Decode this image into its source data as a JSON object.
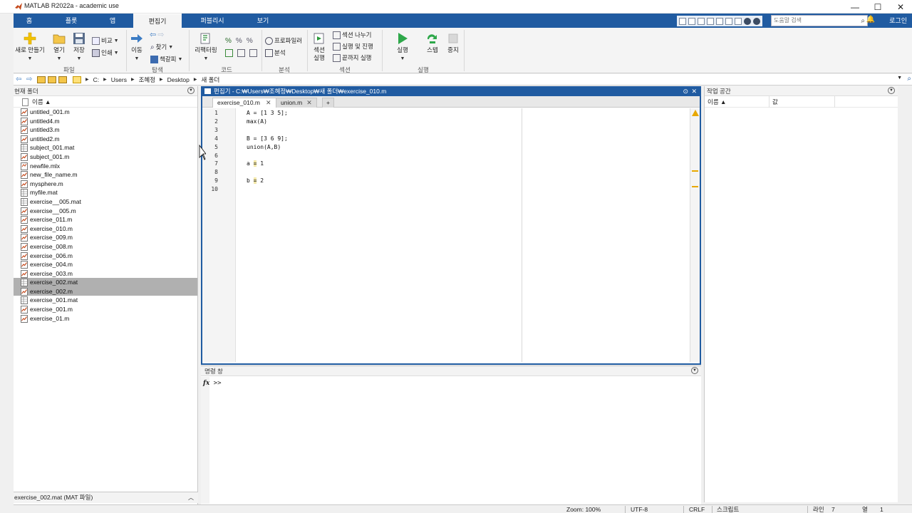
{
  "window": {
    "title": "MATLAB R2022a - academic use",
    "minimize": "—",
    "maximize": "☐",
    "close": "✕"
  },
  "ribbon_tabs": [
    {
      "label": "홈"
    },
    {
      "label": "플롯"
    },
    {
      "label": "앱"
    },
    {
      "label": "편집기"
    },
    {
      "label": "퍼블리시"
    },
    {
      "label": "보기"
    }
  ],
  "active_tab": "편집기",
  "help_search": {
    "placeholder": "도움말 검색"
  },
  "login_label": "로그인",
  "ribbon": {
    "file": {
      "group": "파일",
      "new": "새로 만들기",
      "open": "열기",
      "save": "저장",
      "compare": "비교",
      "print": "인쇄"
    },
    "navigate": {
      "group": "탐색",
      "goto": "이동",
      "find": "찾기",
      "bookmark": "책갈피"
    },
    "code": {
      "group": "코드",
      "refactor": "리팩터링"
    },
    "analyze": {
      "group": "분석",
      "profiler": "프로파일러",
      "analyze": "분석"
    },
    "section": {
      "group": "섹션",
      "run_section_1": "섹션",
      "run_section_2": "실행",
      "section_break": "섹션 나누기",
      "run_advance": "실행 및 진행",
      "run_to_end": "끝까지 실행"
    },
    "run": {
      "group": "실행",
      "run": "실행",
      "step": "스텝",
      "stop": "중지"
    }
  },
  "address": {
    "parts": [
      "C:",
      "Users",
      "조혜정",
      "Desktop",
      "새 폴더"
    ]
  },
  "current_folder": {
    "title": "현재 폴더",
    "column_name": "이름 ▲",
    "files": [
      {
        "name": "untitled_001.m",
        "type": "m"
      },
      {
        "name": "untitled4.m",
        "type": "m"
      },
      {
        "name": "untitled3.m",
        "type": "m"
      },
      {
        "name": "untitled2.m",
        "type": "m"
      },
      {
        "name": "subject_001.mat",
        "type": "mat"
      },
      {
        "name": "subject_001.m",
        "type": "m"
      },
      {
        "name": "newfile.mlx",
        "type": "mlx"
      },
      {
        "name": "new_file_name.m",
        "type": "m"
      },
      {
        "name": "mysphere.m",
        "type": "m"
      },
      {
        "name": "myfile.mat",
        "type": "mat"
      },
      {
        "name": "exercise__005.mat",
        "type": "mat"
      },
      {
        "name": "exercise__005.m",
        "type": "m"
      },
      {
        "name": "exercise_011.m",
        "type": "m"
      },
      {
        "name": "exercise_010.m",
        "type": "m"
      },
      {
        "name": "exercise_009.m",
        "type": "m"
      },
      {
        "name": "exercise_008.m",
        "type": "m"
      },
      {
        "name": "exercise_006.m",
        "type": "m"
      },
      {
        "name": "exercise_004.m",
        "type": "m"
      },
      {
        "name": "exercise_003.m",
        "type": "m"
      },
      {
        "name": "exercise_002.mat",
        "type": "mat",
        "selected": true
      },
      {
        "name": "exercise_002.m",
        "type": "m",
        "selected": true
      },
      {
        "name": "exercise_001.mat",
        "type": "mat"
      },
      {
        "name": "exercise_001.m",
        "type": "m"
      },
      {
        "name": "exercise_01.m",
        "type": "m"
      }
    ],
    "status": "exercise_002.mat  (MAT 파일)"
  },
  "editor": {
    "title": "편집기 - C:₩Users₩조혜정₩Desktop₩새 폴더₩exercise_010.m",
    "tabs": [
      {
        "label": "exercise_010.m",
        "active": true
      },
      {
        "label": "union.m",
        "active": false
      }
    ],
    "add_tab": "+",
    "lines": [
      {
        "n": "1",
        "code": "A = [1 3 5];"
      },
      {
        "n": "2",
        "code": "max(A)"
      },
      {
        "n": "3",
        "code": ""
      },
      {
        "n": "4",
        "code": "B = [3 6 9];"
      },
      {
        "n": "5",
        "code": "union(A,B)"
      },
      {
        "n": "6",
        "code": ""
      },
      {
        "n": "7",
        "code_pre": "a ",
        "code_hl": "=",
        "code_post": " 1"
      },
      {
        "n": "8",
        "code": ""
      },
      {
        "n": "9",
        "code_pre": "b ",
        "code_hl": "=",
        "code_post": " 2"
      },
      {
        "n": "10",
        "code": ""
      }
    ]
  },
  "command_window": {
    "title": "명령 창",
    "fx": "fx",
    "prompt": ">>"
  },
  "workspace": {
    "title": "작업 공간",
    "col_name": "이름 ▲",
    "col_value": "값"
  },
  "statusbar": {
    "zoom": "Zoom: 100%",
    "encoding": "UTF-8",
    "eol": "CRLF",
    "type": "스크립트",
    "line_label": "라인",
    "line": "7",
    "col_label": "열",
    "col": "1"
  }
}
